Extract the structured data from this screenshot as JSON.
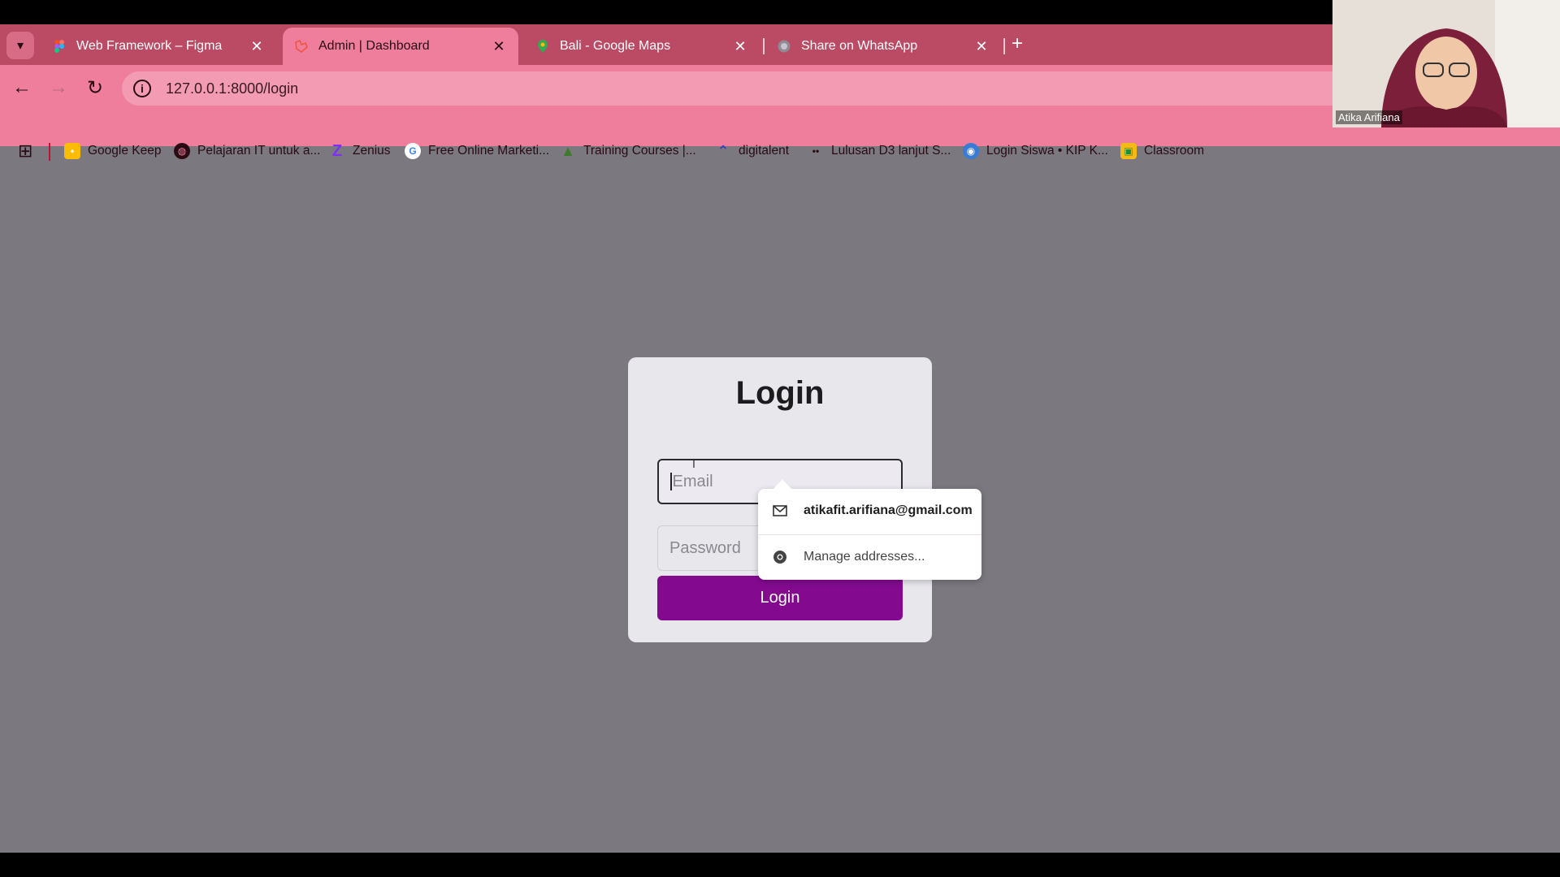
{
  "browser": {
    "tabs": [
      {
        "label": "Web Framework – Figma",
        "active": false
      },
      {
        "label": "Admin | Dashboard",
        "active": true
      },
      {
        "label": "Bali - Google Maps",
        "active": false
      },
      {
        "label": "Share on WhatsApp",
        "active": false
      }
    ],
    "address": "127.0.0.1:8000/login",
    "bookmarks": [
      {
        "label": "Google Keep"
      },
      {
        "label": "Pelajaran IT untuk a..."
      },
      {
        "label": "Zenius"
      },
      {
        "label": "Free Online Marketi..."
      },
      {
        "label": "Training Courses |..."
      },
      {
        "label": "digitalent"
      },
      {
        "label": "Lulusan D3 lanjut S..."
      },
      {
        "label": "Login Siswa • KIP K..."
      },
      {
        "label": "Classroom"
      }
    ]
  },
  "webcam": {
    "name": "Atika Arifiana"
  },
  "login": {
    "title": "Login",
    "email_placeholder": "Email",
    "password_placeholder": "Password",
    "button_label": "Login"
  },
  "autofill": {
    "suggestion": "atikafit.arifiana@gmail.com",
    "manage": "Manage addresses..."
  }
}
